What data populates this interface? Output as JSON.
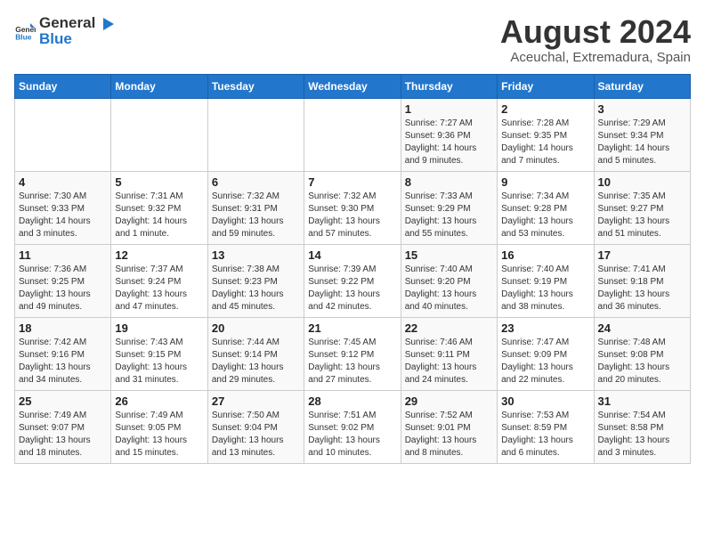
{
  "header": {
    "logo_general": "General",
    "logo_blue": "Blue",
    "month_title": "August 2024",
    "subtitle": "Aceuchal, Extremadura, Spain"
  },
  "weekdays": [
    "Sunday",
    "Monday",
    "Tuesday",
    "Wednesday",
    "Thursday",
    "Friday",
    "Saturday"
  ],
  "weeks": [
    [
      {
        "day": "",
        "info": ""
      },
      {
        "day": "",
        "info": ""
      },
      {
        "day": "",
        "info": ""
      },
      {
        "day": "",
        "info": ""
      },
      {
        "day": "1",
        "info": "Sunrise: 7:27 AM\nSunset: 9:36 PM\nDaylight: 14 hours and 9 minutes."
      },
      {
        "day": "2",
        "info": "Sunrise: 7:28 AM\nSunset: 9:35 PM\nDaylight: 14 hours and 7 minutes."
      },
      {
        "day": "3",
        "info": "Sunrise: 7:29 AM\nSunset: 9:34 PM\nDaylight: 14 hours and 5 minutes."
      }
    ],
    [
      {
        "day": "4",
        "info": "Sunrise: 7:30 AM\nSunset: 9:33 PM\nDaylight: 14 hours and 3 minutes."
      },
      {
        "day": "5",
        "info": "Sunrise: 7:31 AM\nSunset: 9:32 PM\nDaylight: 14 hours and 1 minute."
      },
      {
        "day": "6",
        "info": "Sunrise: 7:32 AM\nSunset: 9:31 PM\nDaylight: 13 hours and 59 minutes."
      },
      {
        "day": "7",
        "info": "Sunrise: 7:32 AM\nSunset: 9:30 PM\nDaylight: 13 hours and 57 minutes."
      },
      {
        "day": "8",
        "info": "Sunrise: 7:33 AM\nSunset: 9:29 PM\nDaylight: 13 hours and 55 minutes."
      },
      {
        "day": "9",
        "info": "Sunrise: 7:34 AM\nSunset: 9:28 PM\nDaylight: 13 hours and 53 minutes."
      },
      {
        "day": "10",
        "info": "Sunrise: 7:35 AM\nSunset: 9:27 PM\nDaylight: 13 hours and 51 minutes."
      }
    ],
    [
      {
        "day": "11",
        "info": "Sunrise: 7:36 AM\nSunset: 9:25 PM\nDaylight: 13 hours and 49 minutes."
      },
      {
        "day": "12",
        "info": "Sunrise: 7:37 AM\nSunset: 9:24 PM\nDaylight: 13 hours and 47 minutes."
      },
      {
        "day": "13",
        "info": "Sunrise: 7:38 AM\nSunset: 9:23 PM\nDaylight: 13 hours and 45 minutes."
      },
      {
        "day": "14",
        "info": "Sunrise: 7:39 AM\nSunset: 9:22 PM\nDaylight: 13 hours and 42 minutes."
      },
      {
        "day": "15",
        "info": "Sunrise: 7:40 AM\nSunset: 9:20 PM\nDaylight: 13 hours and 40 minutes."
      },
      {
        "day": "16",
        "info": "Sunrise: 7:40 AM\nSunset: 9:19 PM\nDaylight: 13 hours and 38 minutes."
      },
      {
        "day": "17",
        "info": "Sunrise: 7:41 AM\nSunset: 9:18 PM\nDaylight: 13 hours and 36 minutes."
      }
    ],
    [
      {
        "day": "18",
        "info": "Sunrise: 7:42 AM\nSunset: 9:16 PM\nDaylight: 13 hours and 34 minutes."
      },
      {
        "day": "19",
        "info": "Sunrise: 7:43 AM\nSunset: 9:15 PM\nDaylight: 13 hours and 31 minutes."
      },
      {
        "day": "20",
        "info": "Sunrise: 7:44 AM\nSunset: 9:14 PM\nDaylight: 13 hours and 29 minutes."
      },
      {
        "day": "21",
        "info": "Sunrise: 7:45 AM\nSunset: 9:12 PM\nDaylight: 13 hours and 27 minutes."
      },
      {
        "day": "22",
        "info": "Sunrise: 7:46 AM\nSunset: 9:11 PM\nDaylight: 13 hours and 24 minutes."
      },
      {
        "day": "23",
        "info": "Sunrise: 7:47 AM\nSunset: 9:09 PM\nDaylight: 13 hours and 22 minutes."
      },
      {
        "day": "24",
        "info": "Sunrise: 7:48 AM\nSunset: 9:08 PM\nDaylight: 13 hours and 20 minutes."
      }
    ],
    [
      {
        "day": "25",
        "info": "Sunrise: 7:49 AM\nSunset: 9:07 PM\nDaylight: 13 hours and 18 minutes."
      },
      {
        "day": "26",
        "info": "Sunrise: 7:49 AM\nSunset: 9:05 PM\nDaylight: 13 hours and 15 minutes."
      },
      {
        "day": "27",
        "info": "Sunrise: 7:50 AM\nSunset: 9:04 PM\nDaylight: 13 hours and 13 minutes."
      },
      {
        "day": "28",
        "info": "Sunrise: 7:51 AM\nSunset: 9:02 PM\nDaylight: 13 hours and 10 minutes."
      },
      {
        "day": "29",
        "info": "Sunrise: 7:52 AM\nSunset: 9:01 PM\nDaylight: 13 hours and 8 minutes."
      },
      {
        "day": "30",
        "info": "Sunrise: 7:53 AM\nSunset: 8:59 PM\nDaylight: 13 hours and 6 minutes."
      },
      {
        "day": "31",
        "info": "Sunrise: 7:54 AM\nSunset: 8:58 PM\nDaylight: 13 hours and 3 minutes."
      }
    ]
  ]
}
